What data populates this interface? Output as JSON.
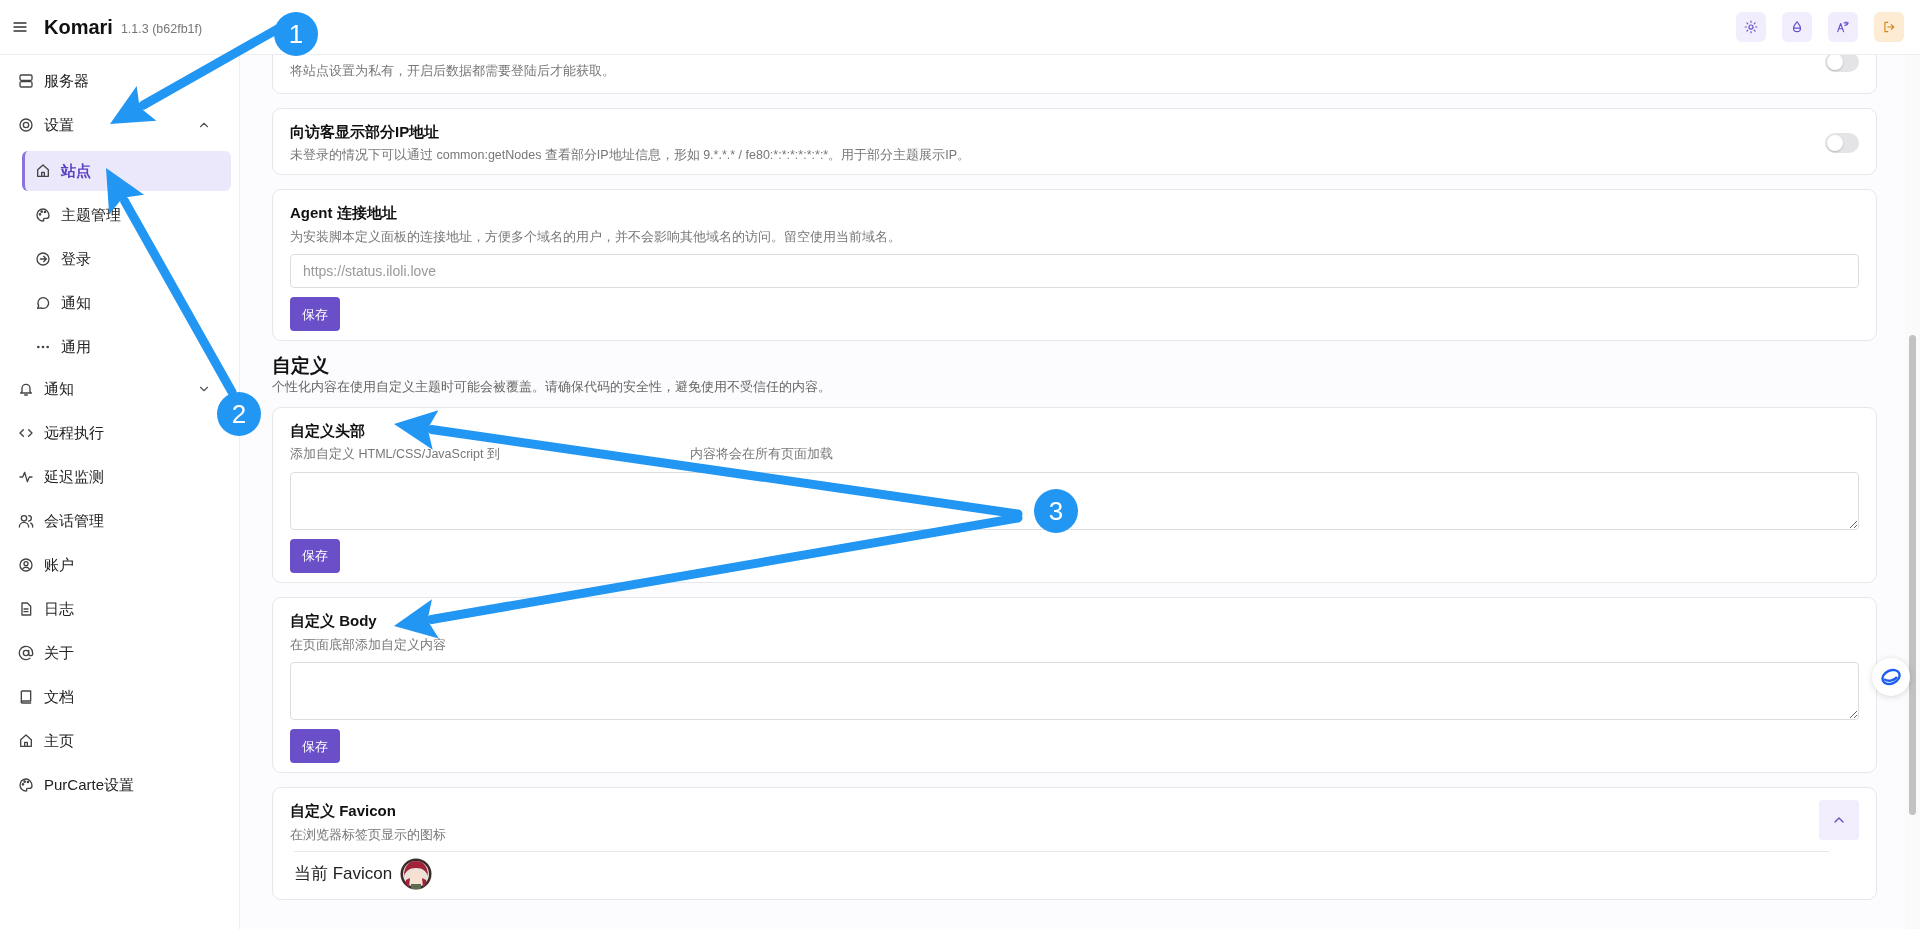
{
  "header": {
    "brand": "Komari",
    "version": "1.1.3 (b62fb1f)"
  },
  "sidebar": {
    "items": [
      {
        "label": "服务器",
        "selected": false
      },
      {
        "label": "设置",
        "selected": false,
        "expanded": true,
        "children": [
          {
            "label": "站点",
            "selected": true
          },
          {
            "label": "主题管理",
            "selected": false
          },
          {
            "label": "登录",
            "selected": false
          },
          {
            "label": "通知",
            "selected": false
          },
          {
            "label": "通用",
            "selected": false
          }
        ]
      },
      {
        "label": "通知",
        "selected": false,
        "expanded": false
      },
      {
        "label": "远程执行",
        "selected": false
      },
      {
        "label": "延迟监测",
        "selected": false
      },
      {
        "label": "会话管理",
        "selected": false
      },
      {
        "label": "账户",
        "selected": false
      },
      {
        "label": "日志",
        "selected": false
      },
      {
        "label": "关于",
        "selected": false
      },
      {
        "label": "文档",
        "selected": false
      },
      {
        "label": "主页",
        "selected": false
      },
      {
        "label": "PurCarte设置",
        "selected": false
      }
    ]
  },
  "sections": [
    {
      "cards": [
        {
          "kind": "toggle",
          "description": "将站点设置为私有，开启后数据都需要登陆后才能获取。",
          "on": false
        },
        {
          "kind": "toggle",
          "title": "向访客显示部分IP地址",
          "description": "未登录的情况下可以通过 common:getNodes 查看部分IP地址信息，形如 9.*.*.* / fe80:*:*:*:*:*:*:*。用于部分主题展示IP。",
          "on": false
        },
        {
          "kind": "input",
          "title": "Agent 连接地址",
          "description": "为安装脚本定义面板的连接地址，方便多个域名的用户，并不会影响其他域名的访问。留空使用当前域名。",
          "placeholder": "https://status.iloli.love",
          "button": "保存"
        }
      ]
    },
    {
      "title": "自定义",
      "subtitle": "个性化内容在使用自定义主题时可能会被覆盖。请确保代码的安全性，避免使用不受信任的内容。",
      "cards": [
        {
          "kind": "textarea",
          "title": "自定义头部",
          "description_parts": [
            "添加自定义 HTML/CSS/JavaScript 到",
            "内容将会在所有页面加载"
          ],
          "button": "保存"
        },
        {
          "kind": "textarea",
          "title": "自定义 Body",
          "description": "在页面底部添加自定义内容",
          "button": "保存"
        },
        {
          "kind": "favicon",
          "title": "自定义 Favicon",
          "description": "在浏览器标签页显示的图标",
          "expanded": true,
          "current_label": "当前 Favicon"
        }
      ]
    }
  ],
  "annotations": [
    {
      "label": "1"
    },
    {
      "label": "2"
    },
    {
      "label": "3"
    }
  ]
}
